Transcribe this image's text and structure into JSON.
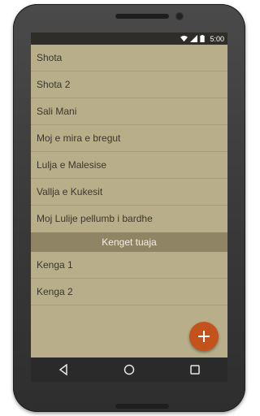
{
  "status": {
    "time": "5:00"
  },
  "list": {
    "items_top": [
      "Shota",
      "Shota 2",
      "Sali Mani",
      "Moj e mira e bregut",
      "Lulja e Malesise",
      "Vallja e Kukesit",
      "Moj Lulije pellumb i bardhe"
    ],
    "section_header": "Kenget tuaja",
    "items_bottom": [
      "Kenga 1",
      "Kenga 2"
    ]
  },
  "fab": {
    "icon": "plus-icon",
    "color": "#c3521d"
  },
  "navbar": {
    "icons": [
      "back-icon",
      "home-icon",
      "recents-icon"
    ]
  },
  "colors": {
    "screen_bg": "#b8ae8a",
    "header_bg": "#8f8463",
    "statusbar_bg": "#2f2d27"
  }
}
